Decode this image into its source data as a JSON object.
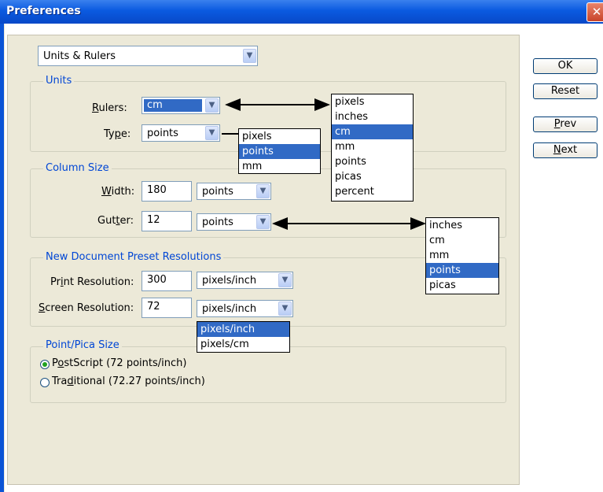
{
  "window": {
    "title": "Preferences",
    "close": "✕"
  },
  "category": {
    "selected": "Units & Rulers"
  },
  "buttons": {
    "ok": "OK",
    "reset": "Reset",
    "prev_u": "P",
    "prev_rest": "rev",
    "next_u": "N",
    "next_rest": "ext"
  },
  "units": {
    "group_label": "Units",
    "rulers_label_u": "R",
    "rulers_label_rest": "ulers:",
    "rulers_value": "cm",
    "type_label_a": "Ty",
    "type_label_u": "p",
    "type_label_b": "e:",
    "type_value": "points"
  },
  "column": {
    "group_label": "Column Size",
    "width_label_u": "W",
    "width_label_rest": "idth:",
    "width_value": "180",
    "width_unit": "points",
    "gutter_label_a": "Gut",
    "gutter_label_u": "t",
    "gutter_label_b": "er:",
    "gutter_value": "12",
    "gutter_unit": "points"
  },
  "resolutions": {
    "group_label": "New Document Preset Resolutions",
    "print_label_a": "Pr",
    "print_label_u": "i",
    "print_label_b": "nt Resolution:",
    "print_value": "300",
    "print_unit": "pixels/inch",
    "screen_label_u": "S",
    "screen_label_rest": "creen Resolution:",
    "screen_value": "72",
    "screen_unit": "pixels/inch"
  },
  "pica": {
    "group_label": "Point/Pica Size",
    "postscript_a": "P",
    "postscript_u": "o",
    "postscript_b": "stScript (72 points/inch)",
    "traditional_a": "Tra",
    "traditional_u": "d",
    "traditional_b": "itional (72.27 points/inch)",
    "selected": "postscript"
  },
  "popups": {
    "rulers": {
      "options": [
        "pixels",
        "inches",
        "cm",
        "mm",
        "points",
        "picas",
        "percent"
      ],
      "selected": "cm"
    },
    "type": {
      "options": [
        "pixels",
        "points",
        "mm"
      ],
      "selected": "points"
    },
    "gutter": {
      "options": [
        "inches",
        "cm",
        "mm",
        "points",
        "picas"
      ],
      "selected": "points"
    },
    "screen": {
      "options": [
        "pixels/inch",
        "pixels/cm"
      ],
      "selected": "pixels/inch"
    }
  },
  "colors": {
    "title_blue": "#0a5ae0",
    "selection": "#316ac5",
    "group_label": "#0046d5",
    "panel": "#ece9d8"
  }
}
